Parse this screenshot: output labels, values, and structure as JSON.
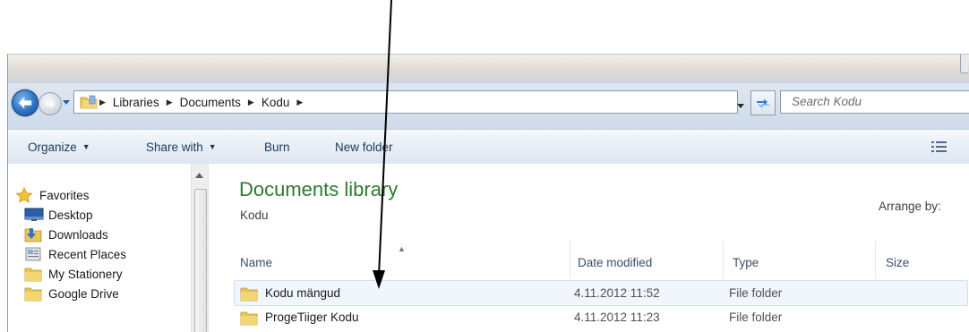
{
  "icons": {
    "back": "back-arrow-icon",
    "forward": "forward-arrow-icon",
    "folder": "folder-icon",
    "refresh": "refresh-icon",
    "views": "views-icon",
    "favorites": "star-icon"
  },
  "colors": {
    "library_title": "#2d7a2d",
    "command_text": "#1e395b",
    "folder_yellow": "#e8c45a"
  },
  "address": {
    "crumbs": [
      "Libraries",
      "Documents",
      "Kodu"
    ]
  },
  "search": {
    "placeholder": "Search Kodu"
  },
  "toolbar": {
    "organize": "Organize",
    "share_with": "Share with",
    "burn": "Burn",
    "new_folder": "New folder"
  },
  "nav": {
    "favorites": "Favorites",
    "items": [
      {
        "label": "Desktop",
        "icon": "desktop-icon"
      },
      {
        "label": "Downloads",
        "icon": "downloads-icon"
      },
      {
        "label": "Recent Places",
        "icon": "recent-places-icon"
      },
      {
        "label": "My Stationery",
        "icon": "folder-icon"
      },
      {
        "label": "Google Drive",
        "icon": "folder-icon"
      }
    ]
  },
  "library": {
    "title": "Documents library",
    "subtitle": "Kodu",
    "arrange_by": "Arrange by:"
  },
  "columns": {
    "name": "Name",
    "date_modified": "Date modified",
    "type": "Type",
    "size": "Size"
  },
  "files": [
    {
      "name": "Kodu mängud",
      "date": "4.11.2012 11:52",
      "type": "File folder"
    },
    {
      "name": "ProgeTiiger Kodu",
      "date": "4.11.2012 11:23",
      "type": "File folder"
    }
  ]
}
